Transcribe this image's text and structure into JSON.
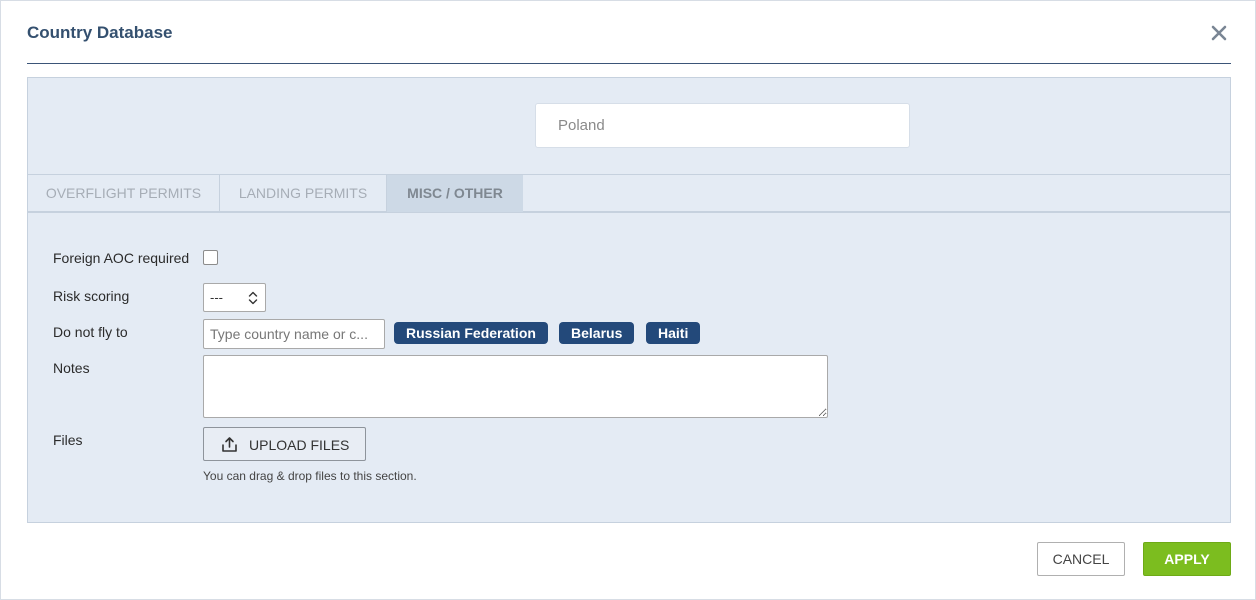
{
  "dialog": {
    "title": "Country Database",
    "close_icon": "close-icon"
  },
  "country": {
    "value": "Poland"
  },
  "tabs": [
    {
      "label": "OVERFLIGHT PERMITS",
      "active": false
    },
    {
      "label": "LANDING PERMITS",
      "active": false
    },
    {
      "label": "MISC / OTHER",
      "active": true
    }
  ],
  "form": {
    "foreign_aoc_label": "Foreign AOC required",
    "foreign_aoc_checked": false,
    "risk_label": "Risk scoring",
    "risk_value": "---",
    "do_not_fly_label": "Do not fly to",
    "do_not_fly_placeholder": "Type country name or c...",
    "do_not_fly_tags": [
      "Russian Federation",
      "Belarus",
      "Haiti"
    ],
    "notes_label": "Notes",
    "notes_value": "",
    "files_label": "Files",
    "upload_label": "UPLOAD FILES",
    "upload_icon": "upload-icon",
    "drag_hint": "You can drag & drop files to this section."
  },
  "footer": {
    "cancel_label": "CANCEL",
    "apply_label": "APPLY"
  },
  "colors": {
    "title": "#34506f",
    "panel_bg": "#e4ebf4",
    "tag_bg": "#23497a",
    "apply_bg": "#7cbd1f"
  }
}
